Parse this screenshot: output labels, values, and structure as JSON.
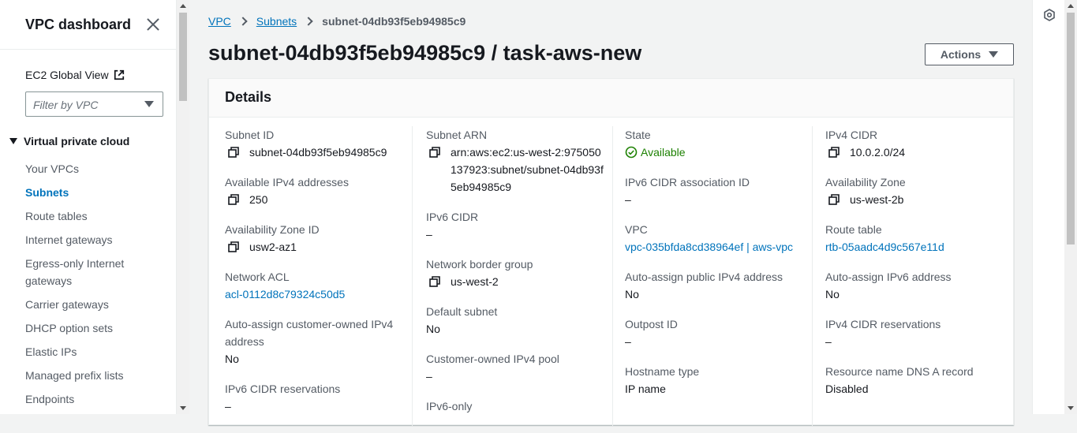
{
  "sidebar": {
    "title": "VPC dashboard",
    "global_view": "EC2 Global View",
    "filter_placeholder": "Filter by VPC",
    "section": "Virtual private cloud",
    "items": [
      {
        "label": "Your VPCs"
      },
      {
        "label": "Subnets"
      },
      {
        "label": "Route tables"
      },
      {
        "label": "Internet gateways"
      },
      {
        "label": "Egress-only Internet gateways"
      },
      {
        "label": "Carrier gateways"
      },
      {
        "label": "DHCP option sets"
      },
      {
        "label": "Elastic IPs"
      },
      {
        "label": "Managed prefix lists"
      },
      {
        "label": "Endpoints"
      }
    ]
  },
  "breadcrumb": {
    "root": "VPC",
    "parent": "Subnets",
    "current": "subnet-04db93f5eb94985c9"
  },
  "page": {
    "title": "subnet-04db93f5eb94985c9 / task-aws-new",
    "actions_label": "Actions"
  },
  "details": {
    "heading": "Details",
    "col1": {
      "subnet_id": {
        "label": "Subnet ID",
        "value": "subnet-04db93f5eb94985c9"
      },
      "available_ipv4": {
        "label": "Available IPv4 addresses",
        "value": "250"
      },
      "az_id": {
        "label": "Availability Zone ID",
        "value": "usw2-az1"
      },
      "network_acl": {
        "label": "Network ACL",
        "value": "acl-0112d8c79324c50d5"
      },
      "auto_customer_owned": {
        "label": "Auto-assign customer-owned IPv4 address",
        "value": "No"
      },
      "ipv6_cidr_reservations": {
        "label": "IPv6 CIDR reservations",
        "value": "–"
      }
    },
    "col2": {
      "subnet_arn": {
        "label": "Subnet ARN",
        "value": "arn:aws:ec2:us-west-2:975050137923:subnet/subnet-04db93f5eb94985c9"
      },
      "ipv6_cidr": {
        "label": "IPv6 CIDR",
        "value": "–"
      },
      "network_border_group": {
        "label": "Network border group",
        "value": "us-west-2"
      },
      "default_subnet": {
        "label": "Default subnet",
        "value": "No"
      },
      "customer_owned_pool": {
        "label": "Customer-owned IPv4 pool",
        "value": "–"
      },
      "ipv6_only": {
        "label": "IPv6-only",
        "value": ""
      }
    },
    "col3": {
      "state": {
        "label": "State",
        "value": "Available"
      },
      "ipv6_assoc_id": {
        "label": "IPv6 CIDR association ID",
        "value": "–"
      },
      "vpc": {
        "label": "VPC",
        "value": "vpc-035bfda8cd38964ef | aws-vpc"
      },
      "auto_public_ipv4": {
        "label": "Auto-assign public IPv4 address",
        "value": "No"
      },
      "outpost_id": {
        "label": "Outpost ID",
        "value": "–"
      },
      "hostname_type": {
        "label": "Hostname type",
        "value": "IP name"
      }
    },
    "col4": {
      "ipv4_cidr": {
        "label": "IPv4 CIDR",
        "value": "10.0.2.0/24"
      },
      "az": {
        "label": "Availability Zone",
        "value": "us-west-2b"
      },
      "route_table": {
        "label": "Route table",
        "value": "rtb-05aadc4d9c567e11d"
      },
      "auto_ipv6": {
        "label": "Auto-assign IPv6 address",
        "value": "No"
      },
      "ipv4_cidr_reservations": {
        "label": "IPv4 CIDR reservations",
        "value": "–"
      },
      "resource_dns_a": {
        "label": "Resource name DNS A record",
        "value": "Disabled"
      }
    }
  },
  "colors": {
    "link": "#0073bb",
    "status_ok": "#1d8102",
    "text": "#16191f",
    "label": "#545b64"
  },
  "icons": [
    "close-icon",
    "external-link-icon",
    "chevron-down-icon",
    "copy-icon",
    "check-circle-icon",
    "settings-icon"
  ]
}
